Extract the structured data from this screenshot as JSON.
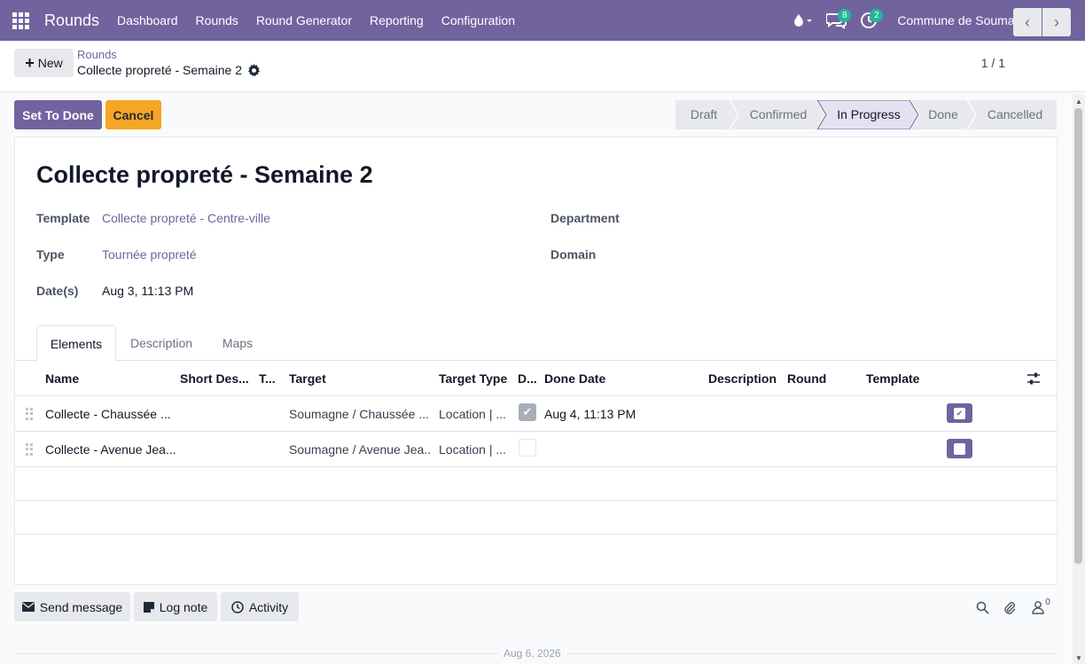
{
  "navbar": {
    "brand": "Rounds",
    "menu": [
      "Dashboard",
      "Rounds",
      "Round Generator",
      "Reporting",
      "Configuration"
    ],
    "messages_count": "8",
    "activities_count": "2",
    "company": "Commune de Soumagne",
    "bg_color": "#71639e"
  },
  "control": {
    "new_label": "New",
    "breadcrumb": "Rounds",
    "record_title": "Collecte propreté - Semaine 2",
    "pager": "1 / 1"
  },
  "statusbar": {
    "set_done": "Set To Done",
    "cancel": "Cancel",
    "stages": [
      "Draft",
      "Confirmed",
      "In Progress",
      "Done",
      "Cancelled"
    ],
    "active_stage": "In Progress"
  },
  "form": {
    "title": "Collecte propreté - Semaine 2",
    "template_label": "Template",
    "template_value": "Collecte propreté - Centre-ville",
    "type_label": "Type",
    "type_value": "Tournée propreté",
    "dates_label": "Date(s)",
    "dates_value": "Aug 3, 11:13 PM",
    "department_label": "Department",
    "domain_label": "Domain"
  },
  "tabs": [
    "Elements",
    "Description",
    "Maps"
  ],
  "table": {
    "headers": [
      "Name",
      "Short Des...",
      "T...",
      "Target",
      "Target Type",
      "D...",
      "Done Date",
      "Description",
      "Round",
      "Template"
    ],
    "rows": [
      {
        "name": "Collecte - Chaussée ...",
        "target": "Soumagne / Chaussée ...",
        "target_type": "Location | ...",
        "done": true,
        "done_date": "Aug 4, 11:13 PM"
      },
      {
        "name": "Collecte - Avenue Jea...",
        "target": "Soumagne / Avenue Jea...",
        "target_type": "Location | ...",
        "done": false,
        "done_date": ""
      }
    ]
  },
  "chatter": {
    "send_message": "Send message",
    "log_note": "Log note",
    "activity": "Activity",
    "followers_count": "0",
    "date_separator": "Aug 6, 2026"
  }
}
